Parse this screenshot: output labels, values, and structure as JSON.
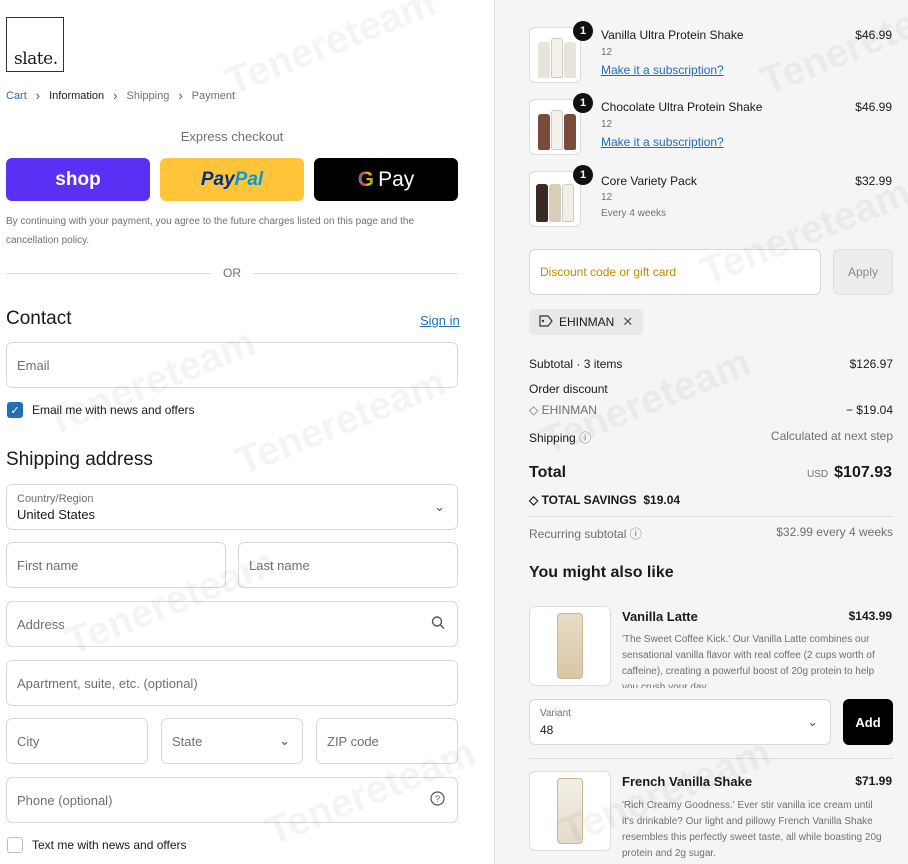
{
  "brand": {
    "logo_text": "slate."
  },
  "breadcrumbs": [
    {
      "label": "Cart"
    },
    {
      "label": "Information"
    },
    {
      "label": "Shipping"
    },
    {
      "label": "Payment"
    }
  ],
  "express": {
    "heading": "Express checkout",
    "shop_label": "shop",
    "paypal_p1": "Pay",
    "paypal_p2": "Pal",
    "gpay_g": "G",
    "gpay_label": "Pay"
  },
  "consent_text": "By continuing with your payment, you agree to the future charges listed on this page and the cancellation policy.",
  "or_label": "OR",
  "contact": {
    "title": "Contact",
    "signin": "Sign in",
    "email_placeholder": "Email",
    "news_label": "Email me with news and offers"
  },
  "shipping": {
    "title": "Shipping address",
    "country_label": "Country/Region",
    "country_value": "United States",
    "first_name": "First name",
    "last_name": "Last name",
    "address": "Address",
    "apartment": "Apartment, suite, etc. (optional)",
    "city": "City",
    "state": "State",
    "zip": "ZIP code",
    "phone": "Phone (optional)",
    "sms_label": "Text me with news and offers"
  },
  "order": {
    "items": [
      {
        "qty": "1",
        "name": "Vanilla Ultra Protein Shake",
        "variant": "12",
        "link": "Make it a subscription?",
        "price": "$46.99"
      },
      {
        "qty": "1",
        "name": "Chocolate Ultra Protein Shake",
        "variant": "12",
        "link": "Make it a subscription?",
        "price": "$46.99"
      },
      {
        "qty": "1",
        "name": "Core Variety Pack",
        "variant": "12",
        "frequency": "Every 4 weeks",
        "price": "$32.99"
      }
    ],
    "discount_placeholder": "Discount code or gift card",
    "apply": "Apply",
    "code": "EHINMAN",
    "subtotal_label": "Subtotal · 3 items",
    "subtotal": "$126.97",
    "order_discount_label": "Order discount",
    "discount_code": "EHINMAN",
    "discount_value": "− $19.04",
    "shipping_label": "Shipping",
    "shipping_value": "Calculated at next step",
    "total_label": "Total",
    "currency": "USD",
    "total": "$107.93",
    "savings": "TOTAL SAVINGS  $19.04",
    "recurring_label": "Recurring subtotal",
    "recurring_value": "$32.99 every 4 weeks"
  },
  "recommend": {
    "title": "You might also like",
    "items": [
      {
        "name": "Vanilla Latte",
        "price": "$143.99",
        "desc": "'The Sweet Coffee Kick.' Our Vanilla Latte combines our sensational vanilla flavor with real coffee (2 cups worth of caffeine), creating a powerful boost of 20g protein to help you crush your day.",
        "variant_label": "Variant",
        "variant_value": "48",
        "add": "Add"
      },
      {
        "name": "French Vanilla Shake",
        "price": "$71.99",
        "desc": "'Rich Creamy Goodness.' Ever stir vanilla ice cream until it's drinkable? Our light and pillowy French Vanilla Shake resembles this perfectly sweet taste, all while boasting 20g protein and 2g sugar."
      }
    ]
  },
  "watermark": "Tenereteam",
  "colors": {
    "accent": "#1f6fb5",
    "shop": "#5a31f4",
    "paypal": "#ffc439",
    "gpay": "#000000"
  }
}
